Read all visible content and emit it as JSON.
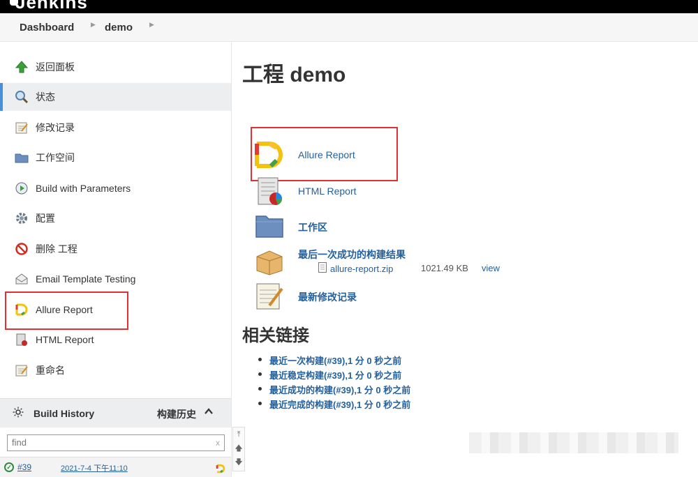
{
  "header": {
    "app_title": "Jenkins"
  },
  "breadcrumb": {
    "items": [
      "Dashboard",
      "demo"
    ]
  },
  "sidebar": {
    "items": [
      {
        "label": "返回面板",
        "icon": "up-arrow-icon"
      },
      {
        "label": "状态",
        "icon": "magnifier-icon",
        "active": true
      },
      {
        "label": "修改记录",
        "icon": "notepad-icon"
      },
      {
        "label": "工作空间",
        "icon": "folder-icon"
      },
      {
        "label": "Build with Parameters",
        "icon": "clock-play-icon"
      },
      {
        "label": "配置",
        "icon": "gear-icon"
      },
      {
        "label": "删除 工程",
        "icon": "no-entry-icon"
      },
      {
        "label": "Email Template Testing",
        "icon": "envelope-icon"
      },
      {
        "label": "Allure Report",
        "icon": "allure-icon"
      },
      {
        "label": "HTML Report",
        "icon": "html-report-icon"
      },
      {
        "label": "重命名",
        "icon": "notepad-icon"
      }
    ]
  },
  "build_history": {
    "title": "Build History",
    "title_zh": "构建历史",
    "find_placeholder": "find",
    "find_clear": "x",
    "builds": [
      {
        "number": "#39",
        "date": "2021-7-4 下午11:10",
        "status": "success"
      }
    ]
  },
  "main": {
    "title": "工程 demo",
    "links": [
      {
        "label": "Allure Report",
        "icon": "allure-icon"
      },
      {
        "label": "HTML Report",
        "icon": "html-report-icon"
      },
      {
        "label": "工作区",
        "icon": "folder-icon"
      },
      {
        "label": "最后一次成功的构建结果",
        "icon": "package-icon"
      },
      {
        "label": "最新修改记录",
        "icon": "notepad-icon"
      }
    ],
    "artifact": {
      "name": "allure-report.zip",
      "size": "1021.49 KB",
      "view": "view"
    },
    "related_title": "相关链接",
    "related_links": [
      "最近一次构建(#39),1 分 0 秒之前",
      "最近稳定构建(#39),1 分 0 秒之前",
      "最近成功的构建(#39),1 分 0 秒之前",
      "最近完成的构建(#39),1 分 0 秒之前"
    ]
  },
  "colors": {
    "link": "#24609c",
    "highlight_box": "#e03030",
    "active_accent": "#4a90d9",
    "success": "#2e8b3e"
  }
}
